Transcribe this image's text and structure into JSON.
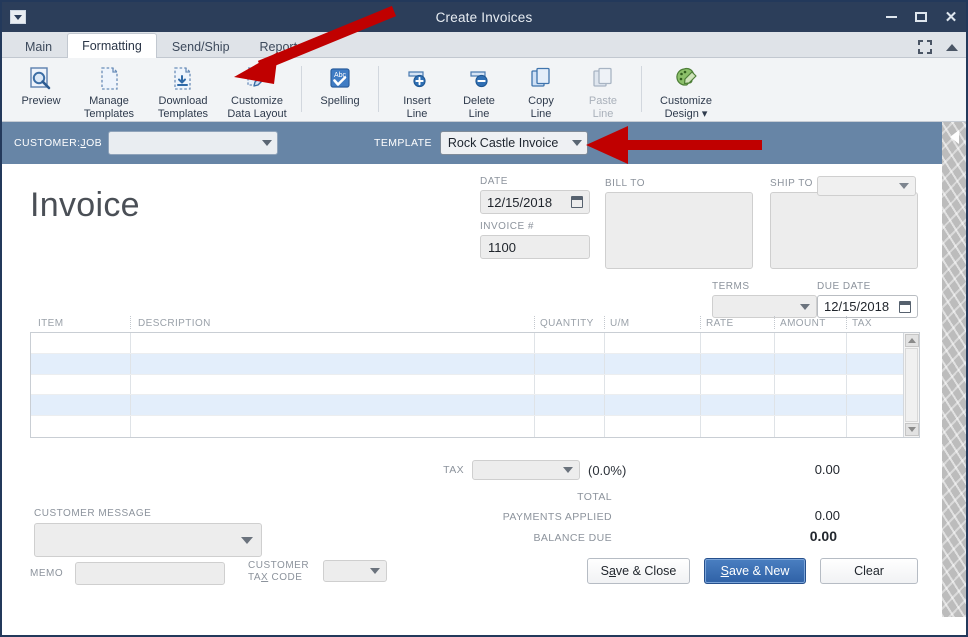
{
  "window": {
    "title": "Create Invoices",
    "system_menu_icon": "window-menu-icon",
    "minimize_label": "Minimize",
    "maximize_label": "Maximize",
    "close_label": "Close"
  },
  "tabs": [
    {
      "label": "Main",
      "active": false
    },
    {
      "label": "Formatting",
      "active": true
    },
    {
      "label": "Send/Ship",
      "active": false
    },
    {
      "label": "Reports",
      "active": false
    }
  ],
  "tabstrip_right": {
    "expand_icon": "expand-icon",
    "collapse_ribbon_icon": "chevron-up-icon"
  },
  "ribbon": {
    "groups": [
      {
        "buttons": [
          {
            "label": "Preview",
            "icon": "preview-magnifier-icon",
            "disabled": false
          },
          {
            "label": "Manage\nTemplates",
            "icon": "manage-templates-icon",
            "disabled": false
          },
          {
            "label": "Download\nTemplates",
            "icon": "download-templates-icon",
            "disabled": false
          },
          {
            "label": "Customize\nData Layout",
            "icon": "customize-data-layout-icon",
            "disabled": false
          }
        ]
      },
      {
        "buttons": [
          {
            "label": "Spelling",
            "icon": "spelling-abc-check-icon",
            "disabled": false
          }
        ]
      },
      {
        "buttons": [
          {
            "label": "Insert\nLine",
            "icon": "insert-line-icon",
            "disabled": false
          },
          {
            "label": "Delete\nLine",
            "icon": "delete-line-icon",
            "disabled": false
          },
          {
            "label": "Copy\nLine",
            "icon": "copy-line-icon",
            "disabled": false
          },
          {
            "label": "Paste\nLine",
            "icon": "paste-line-icon",
            "disabled": true
          }
        ]
      },
      {
        "buttons": [
          {
            "label": "Customize\nDesign ▾",
            "icon": "customize-design-palette-icon",
            "disabled": false
          }
        ]
      }
    ]
  },
  "customer_bar": {
    "customer_job_label": "CUSTOMER:JOB",
    "customer_job_accel": "J",
    "customer_job_value": "",
    "template_label": "TEMPLATE",
    "template_value": "Rock Castle Invoice"
  },
  "form": {
    "heading": "Invoice",
    "date_label": "DATE",
    "date_value": "12/15/2018",
    "invoice_no_label": "INVOICE #",
    "invoice_no_value": "1100",
    "bill_to_label": "BILL TO",
    "bill_to_value": "",
    "ship_to_label": "SHIP TO",
    "ship_to_value": "",
    "ship_to_select_value": "",
    "terms_label": "TERMS",
    "terms_value": "",
    "due_date_label": "DUE DATE",
    "due_date_value": "12/15/2018"
  },
  "line_items": {
    "columns": [
      "ITEM",
      "DESCRIPTION",
      "QUANTITY",
      "U/M",
      "RATE",
      "AMOUNT",
      "TAX"
    ],
    "rows": [
      {
        "item": "",
        "description": "",
        "quantity": "",
        "um": "",
        "rate": "",
        "amount": "",
        "tax": ""
      },
      {
        "item": "",
        "description": "",
        "quantity": "",
        "um": "",
        "rate": "",
        "amount": "",
        "tax": ""
      },
      {
        "item": "",
        "description": "",
        "quantity": "",
        "um": "",
        "rate": "",
        "amount": "",
        "tax": ""
      },
      {
        "item": "",
        "description": "",
        "quantity": "",
        "um": "",
        "rate": "",
        "amount": "",
        "tax": ""
      },
      {
        "item": "",
        "description": "",
        "quantity": "",
        "um": "",
        "rate": "",
        "amount": "",
        "tax": ""
      }
    ]
  },
  "totals": {
    "tax_label": "TAX",
    "tax_select_value": "",
    "tax_rate_text": "(0.0%)",
    "tax_amount": "0.00",
    "total_label": "TOTAL",
    "total_amount": "",
    "payments_applied_label": "PAYMENTS APPLIED",
    "payments_applied_amount": "0.00",
    "balance_due_label": "BALANCE DUE",
    "balance_due_amount": "0.00"
  },
  "footer": {
    "customer_message_label": "CUSTOMER MESSAGE",
    "customer_message_value": "",
    "memo_label": "MEMO",
    "memo_value": "",
    "customer_tax_code_label": "CUSTOMER\nTAX CODE",
    "customer_tax_code_accel": "X",
    "customer_tax_code_value": "",
    "save_close_label": "Save & Close",
    "save_new_label": "Save & New",
    "clear_label": "Clear"
  },
  "side_panel": {
    "collapse_icon": "chevron-left-icon"
  },
  "annotations": {
    "arrow_color": "#c00000",
    "arrow_1_target": "customize-data-layout-button",
    "arrow_2_target": "template-dropdown"
  },
  "colors": {
    "titlebar": "#2c3e5a",
    "customer_bar": "#6785a6",
    "primary_button": "#2f61a6",
    "grid_alt_row": "#e3eefb",
    "annotation_red": "#c00000"
  }
}
